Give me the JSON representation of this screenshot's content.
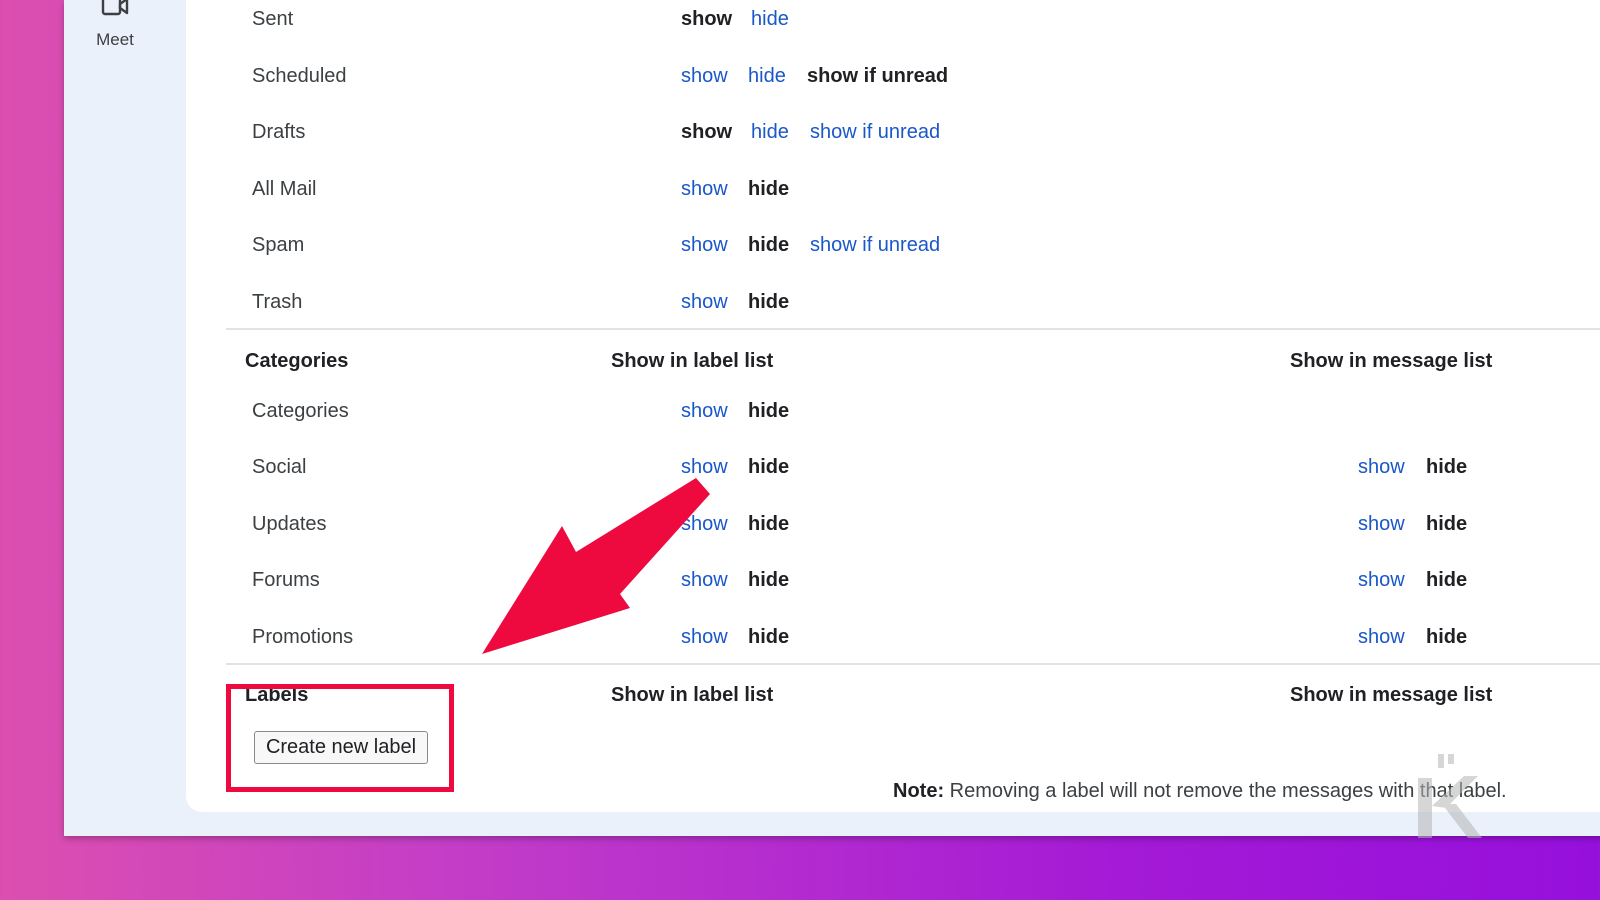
{
  "rail": {
    "meet_label": "Meet"
  },
  "system_labels": [
    {
      "name": "Sent",
      "options": [
        {
          "text": "show",
          "active": true
        },
        {
          "text": "hide",
          "active": false
        }
      ]
    },
    {
      "name": "Scheduled",
      "options": [
        {
          "text": "show",
          "active": false
        },
        {
          "text": "hide",
          "active": false
        },
        {
          "text": "show if unread",
          "active": true
        }
      ]
    },
    {
      "name": "Drafts",
      "options": [
        {
          "text": "show",
          "active": true
        },
        {
          "text": "hide",
          "active": false
        },
        {
          "text": "show if unread",
          "active": false
        }
      ]
    },
    {
      "name": "All Mail",
      "options": [
        {
          "text": "show",
          "active": false
        },
        {
          "text": "hide",
          "active": true
        }
      ]
    },
    {
      "name": "Spam",
      "options": [
        {
          "text": "show",
          "active": false
        },
        {
          "text": "hide",
          "active": true
        },
        {
          "text": "show if unread",
          "active": false
        }
      ]
    },
    {
      "name": "Trash",
      "options": [
        {
          "text": "show",
          "active": false
        },
        {
          "text": "hide",
          "active": true
        }
      ]
    }
  ],
  "categories": {
    "heading": "Categories",
    "col_label_list": "Show in label list",
    "col_message_list": "Show in message list",
    "rows": [
      {
        "name": "Categories",
        "label_list": {
          "show": "show",
          "hide": "hide",
          "selected": "hide"
        },
        "message_list": null
      },
      {
        "name": "Social",
        "label_list": {
          "show": "show",
          "hide": "hide",
          "selected": "hide"
        },
        "message_list": {
          "show": "show",
          "hide": "hide",
          "selected": "hide"
        }
      },
      {
        "name": "Updates",
        "label_list": {
          "show": "show",
          "hide": "hide",
          "selected": "hide"
        },
        "message_list": {
          "show": "show",
          "hide": "hide",
          "selected": "hide"
        }
      },
      {
        "name": "Forums",
        "label_list": {
          "show": "show",
          "hide": "hide",
          "selected": "hide"
        },
        "message_list": {
          "show": "show",
          "hide": "hide",
          "selected": "hide"
        }
      },
      {
        "name": "Promotions",
        "label_list": {
          "show": "show",
          "hide": "hide",
          "selected": "hide"
        },
        "message_list": {
          "show": "show",
          "hide": "hide",
          "selected": "hide"
        }
      }
    ]
  },
  "labels_section": {
    "heading": "Labels",
    "col_label_list": "Show in label list",
    "col_message_list": "Show in message list",
    "create_button": "Create new label",
    "note_bold": "Note:",
    "note_text": " Removing a label will not remove the messages with that label."
  },
  "colors": {
    "link": "#1a57c9",
    "highlight_red": "#ee0a3f",
    "panel_bg": "#ffffff",
    "rail_bg": "#eaf1fb"
  }
}
